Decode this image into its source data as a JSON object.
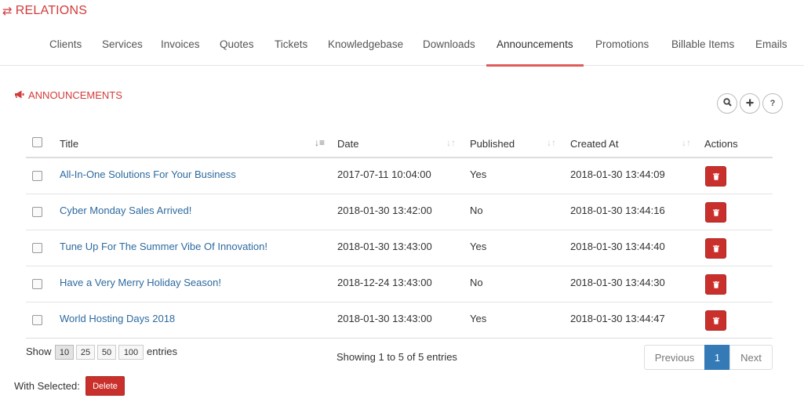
{
  "header": {
    "title": "RELATIONS",
    "icon": "exchange-icon"
  },
  "tabs": [
    {
      "label": "Clients"
    },
    {
      "label": "Services"
    },
    {
      "label": "Invoices"
    },
    {
      "label": "Quotes"
    },
    {
      "label": "Tickets"
    },
    {
      "label": "Knowledgebase"
    },
    {
      "label": "Downloads"
    },
    {
      "label": "Announcements",
      "active": true
    },
    {
      "label": "Promotions"
    },
    {
      "label": "Billable Items"
    },
    {
      "label": "Emails"
    }
  ],
  "section": {
    "title": "ANNOUNCEMENTS",
    "icon": "bullhorn-icon"
  },
  "toolbar": {
    "search_icon": "search-icon",
    "add_icon": "plus-icon",
    "help_label": "?"
  },
  "table": {
    "columns": {
      "title": "Title",
      "date": "Date",
      "published": "Published",
      "created_at": "Created At",
      "actions": "Actions"
    },
    "rows": [
      {
        "title": "All-In-One Solutions For Your Business",
        "date": "2017-07-11 10:04:00",
        "published": "Yes",
        "created_at": "2018-01-30 13:44:09"
      },
      {
        "title": "Cyber Monday Sales Arrived!",
        "date": "2018-01-30 13:42:00",
        "published": "No",
        "created_at": "2018-01-30 13:44:16"
      },
      {
        "title": "Tune Up For The Summer Vibe Of Innovation!",
        "date": "2018-01-30 13:43:00",
        "published": "Yes",
        "created_at": "2018-01-30 13:44:40"
      },
      {
        "title": "Have a Very Merry Holiday Season!",
        "date": "2018-12-24 13:43:00",
        "published": "No",
        "created_at": "2018-01-30 13:44:30"
      },
      {
        "title": "World Hosting Days 2018",
        "date": "2018-01-30 13:43:00",
        "published": "Yes",
        "created_at": "2018-01-30 13:44:47"
      }
    ]
  },
  "footer": {
    "show_label": "Show",
    "lengths": [
      "10",
      "25",
      "50",
      "100"
    ],
    "entries_label": "entries",
    "info": "Showing 1 to 5 of 5 entries",
    "previous": "Previous",
    "current_page": "1",
    "next": "Next",
    "with_selected": "With Selected:",
    "bulk_delete": "Delete"
  },
  "colors": {
    "accent": "#d33a3a",
    "link": "#2d6a9f",
    "danger": "#c9302c",
    "primary": "#337ab7"
  }
}
